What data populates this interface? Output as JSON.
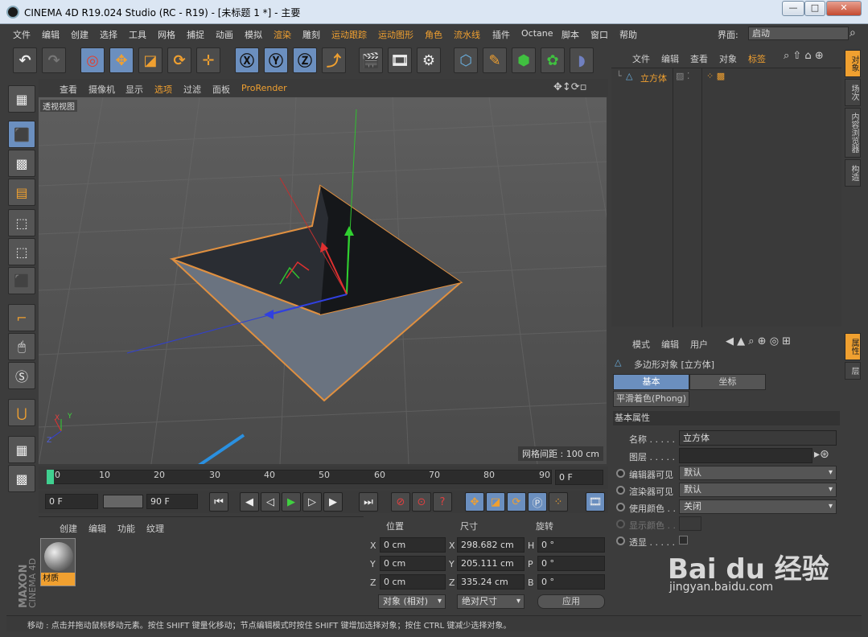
{
  "window": {
    "title": "CINEMA 4D R19.024 Studio (RC - R19) - [未标题 1 *] - 主要",
    "min": "—",
    "max": "□",
    "close": "✕"
  },
  "menu": [
    "文件",
    "编辑",
    "创建",
    "选择",
    "工具",
    "网格",
    "捕捉",
    "动画",
    "模拟",
    "渲染",
    "雕刻",
    "运动跟踪",
    "运动图形",
    "角色",
    "流水线",
    "插件",
    "Octane",
    "脚本",
    "窗口",
    "帮助"
  ],
  "layout": {
    "label": "界面:",
    "value": "启动"
  },
  "viewport_menu": [
    "查看",
    "摄像机",
    "显示",
    "选项",
    "过滤",
    "面板",
    "ProRender"
  ],
  "viewport": {
    "label": "透视视图",
    "grid_spacing": "网格间距 : 100 cm",
    "axis_x": "X",
    "axis_y": "Y",
    "axis_z": "Z"
  },
  "timeline": {
    "ticks": [
      "0",
      "10",
      "20",
      "30",
      "40",
      "50",
      "60",
      "70",
      "80",
      "90"
    ],
    "end_frame": "0 F"
  },
  "transport": {
    "start": "0 F",
    "end": "90 F"
  },
  "material_tabs": [
    "创建",
    "编辑",
    "功能",
    "纹理"
  ],
  "material": {
    "name": "材质"
  },
  "coords": {
    "headers": [
      "位置",
      "尺寸",
      "旋转"
    ],
    "pos": [
      {
        "axis": "X",
        "val": "0 cm"
      },
      {
        "axis": "Y",
        "val": "0 cm"
      },
      {
        "axis": "Z",
        "val": "0 cm"
      }
    ],
    "size": [
      {
        "axis": "X",
        "val": "298.682 cm"
      },
      {
        "axis": "Y",
        "val": "205.111 cm"
      },
      {
        "axis": "Z",
        "val": "335.24 cm"
      }
    ],
    "rot": [
      {
        "axis": "H",
        "val": "0 °"
      },
      {
        "axis": "P",
        "val": "0 °"
      },
      {
        "axis": "B",
        "val": "0 °"
      }
    ],
    "mode": "对象 (相对)",
    "size_mode": "绝对尺寸",
    "apply": "应用"
  },
  "sidelogo": {
    "brand": "MAXON",
    "product": "CINEMA 4D"
  },
  "object_manager": {
    "menu": [
      "文件",
      "编辑",
      "查看",
      "对象",
      "标签"
    ],
    "object": "立方体"
  },
  "attributes": {
    "menu": [
      "模式",
      "编辑",
      "用户"
    ],
    "title": "多边形对象 [立方体]",
    "tabs": [
      "基本",
      "坐标"
    ],
    "tab3": "平滑着色(Phong)",
    "section": "基本属性",
    "rows": [
      {
        "label": "名称 . . . . .",
        "value": "立方体"
      },
      {
        "label": "图层 . . . . .",
        "value": ""
      },
      {
        "label": "编辑器可见",
        "value": "默认"
      },
      {
        "label": "渲染器可见",
        "value": "默认"
      },
      {
        "label": "使用颜色 . .",
        "value": "关闭"
      },
      {
        "label": "显示颜色 . .",
        "value": ""
      },
      {
        "label": "透显 . . . . .",
        "value": ""
      }
    ]
  },
  "right_tabs": [
    "对象",
    "场次",
    "内容浏览器",
    "构造",
    "属性",
    "层"
  ],
  "status": "移动 : 点击并拖动鼠标移动元素。按住 SHIFT 键量化移动；节点编辑模式时按住 SHIFT 键增加选择对象；按住 CTRL 键减少选择对象。",
  "watermark": {
    "brand": "Bai du 经验",
    "url": "jingyan.baidu.com"
  },
  "colors": {
    "accent": "#f0a030",
    "selected": "#6b8fbf",
    "bg": "#3c3c3c"
  }
}
